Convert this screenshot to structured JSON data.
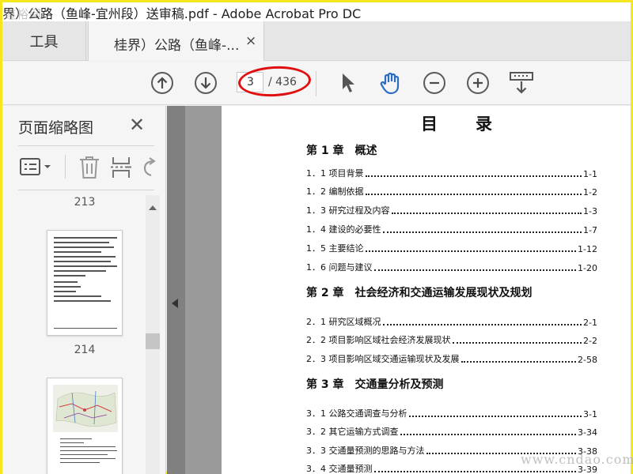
{
  "window": {
    "title": "界）公路（鱼峰-宜州段）送审稿.pdf - Adobe Acrobat Pro DC"
  },
  "watermark": {
    "top": "道裕网",
    "bottom": "www.cndao.com"
  },
  "tabs": {
    "tools": "工具",
    "document": "桂界）公路（鱼峰-...",
    "close": "×"
  },
  "toolbar": {
    "page_current": "3",
    "page_total": "/ 436",
    "icons": [
      "prev-page-icon",
      "next-page-icon",
      "select-cursor-icon",
      "hand-tool-icon",
      "zoom-out-icon",
      "zoom-in-icon",
      "fit-width-icon"
    ]
  },
  "sidebar": {
    "title": "页面缩略图",
    "close": "✕",
    "pages": [
      "213",
      "214"
    ]
  },
  "toc": {
    "title": "目　　录",
    "chapters": [
      {
        "heading": "第 1 章　概述",
        "entries": [
          {
            "label": "1．1 项目背景",
            "page": "1-1"
          },
          {
            "label": "1．2 编制依据",
            "page": "1-2"
          },
          {
            "label": "1．3 研究过程及内容",
            "page": "1-3"
          },
          {
            "label": "1．4 建设的必要性",
            "page": "1-7"
          },
          {
            "label": "1．5 主要结论",
            "page": "1-12"
          },
          {
            "label": "1．6 问题与建议",
            "page": "1-20"
          }
        ]
      },
      {
        "heading": "第 2 章　社会经济和交通运输发展现状及规划",
        "entries": [
          {
            "label": "2．1 研究区域概况",
            "page": "2-1"
          },
          {
            "label": "2．2 项目影响区域社会经济发展现状",
            "page": "2-2"
          },
          {
            "label": "2．3 项目影响区域交通运输现状及发展",
            "page": "2-58"
          }
        ]
      },
      {
        "heading": "第 3 章　交通量分析及预测",
        "entries": [
          {
            "label": "3．1 公路交通调查与分析",
            "page": "3-1"
          },
          {
            "label": "3．2 其它运输方式调查",
            "page": "3-34"
          },
          {
            "label": "3．3 交通量预测的思路与方法",
            "page": "3-38"
          },
          {
            "label": "3．4 交通量预测",
            "page": "3-39"
          }
        ]
      }
    ]
  },
  "colors": {
    "accent_blue": "#2b6cc4",
    "annotation_red": "#e01010",
    "frame_yellow": "#f5e61e"
  }
}
